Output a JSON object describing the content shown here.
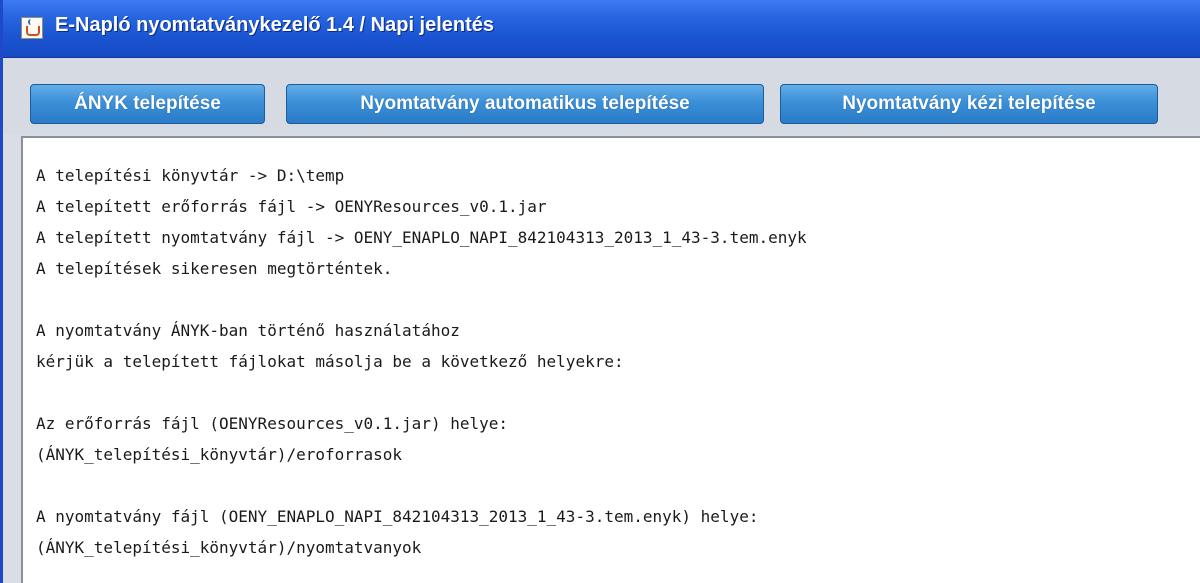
{
  "window": {
    "title": "E-Napló nyomtatványkezelő 1.4 / Napi jelentés",
    "icon": "java-cup-icon"
  },
  "toolbar": {
    "buttons": [
      {
        "label": "ÁNYK telepítése"
      },
      {
        "label": "Nyomtatvány automatikus telepítése"
      },
      {
        "label": "Nyomtatvány kézi telepítése"
      }
    ]
  },
  "output": {
    "lines": [
      "A telepítési könyvtár -> D:\\temp",
      "A telepített erőforrás fájl -> OENYResources_v0.1.jar",
      "A telepített nyomtatvány fájl -> OENY_ENAPLO_NAPI_842104313_2013_1_43-3.tem.enyk",
      "A telepítések sikeresen megtörténtek.",
      "",
      "A nyomtatvány ÁNYK-ban történő használatához",
      "kérjük a telepített fájlokat másolja be a következő helyekre:",
      "",
      "Az erőforrás fájl (OENYResources_v0.1.jar) helye:",
      "(ÁNYK_telepítési_könyvtár)/eroforrasok",
      "",
      "A nyomtatvány fájl (OENY_ENAPLO_NAPI_842104313_2013_1_43-3.tem.enyk) helye:",
      "(ÁNYK_telepítési_könyvtár)/nyomtatvanyok"
    ]
  },
  "colors": {
    "titlebar": "#1a52d0",
    "button": "#3b8fd7",
    "toolbar_bg": "#d6dbe3"
  }
}
